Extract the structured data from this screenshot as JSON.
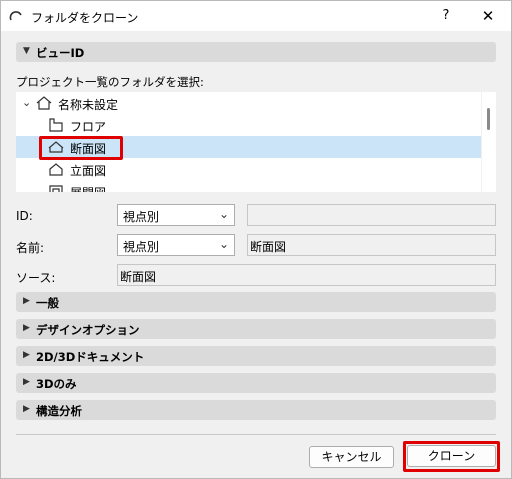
{
  "window": {
    "title": "フォルダをクローン",
    "help": "?",
    "close": "✕"
  },
  "view_id_section": {
    "label": "ビューID",
    "prompt": "プロジェクト一覧のフォルダを選択:"
  },
  "tree": [
    {
      "label": "名称未設定",
      "expanded": true,
      "icon": "project-house-icon",
      "selected": false
    },
    {
      "label": "フロア",
      "icon": "floor-icon",
      "selected": false
    },
    {
      "label": "断面図",
      "icon": "section-icon",
      "selected": true
    },
    {
      "label": "立面図",
      "icon": "elevation-icon",
      "selected": false
    },
    {
      "label": "展開図",
      "icon": "interior-elevation-icon",
      "selected": false
    }
  ],
  "fields": {
    "id": {
      "label": "ID:",
      "dropdown": "視点別",
      "text": ""
    },
    "name": {
      "label": "名前:",
      "dropdown": "視点別",
      "text": "断面図"
    },
    "source": {
      "label": "ソース:",
      "text": "断面図"
    }
  },
  "sections": [
    {
      "label": "一般"
    },
    {
      "label": "デザインオプション"
    },
    {
      "label": "2D/3Dドキュメント"
    },
    {
      "label": "3Dのみ"
    },
    {
      "label": "構造分析"
    }
  ],
  "buttons": {
    "cancel": "キャンセル",
    "clone": "クローン"
  },
  "colors": {
    "selection": "#cce4f7",
    "highlight": "#e00000"
  }
}
